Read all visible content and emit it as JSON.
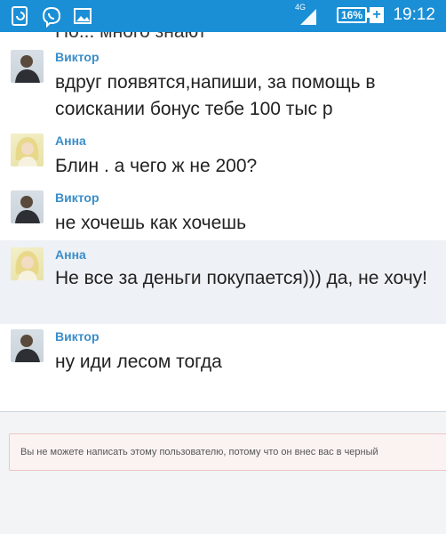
{
  "statusbar": {
    "time": "19:12",
    "battery": "16%",
    "network": "4G",
    "icons": [
      "sync-icon",
      "viber-icon",
      "gallery-icon",
      "signal-icon",
      "battery-icon"
    ]
  },
  "chat": {
    "truncated_top_text": "Но... много знают (обрезано)",
    "messages": [
      {
        "author": "Виктор",
        "text": "вдруг появятся,напиши, за помощь в соискании бонус тебе 100 тыс р",
        "avatar": "viktor-avatar"
      },
      {
        "author": "Анна",
        "text": "Блин . а чего ж не 200?",
        "avatar": "anna-avatar"
      },
      {
        "author": "Виктор",
        "text": "не хочешь как хочешь",
        "avatar": "viktor-avatar"
      },
      {
        "author": "Анна",
        "text": "Не все за деньги покупается))) да, не хочу!",
        "avatar": "anna-avatar"
      },
      {
        "author": "Виктор",
        "text": "ну иди лесом тогда",
        "avatar": "viktor-avatar"
      }
    ]
  },
  "notice": {
    "text": "Вы не можете написать этому пользователю, потому что он внес вас в черный"
  },
  "colors": {
    "statusbar": "#1a8fd6",
    "author": "#3a8ec9",
    "highlight_bg": "#eef1f5",
    "notice_bg": "#fbf3f2",
    "notice_border": "#ecc7c3"
  }
}
